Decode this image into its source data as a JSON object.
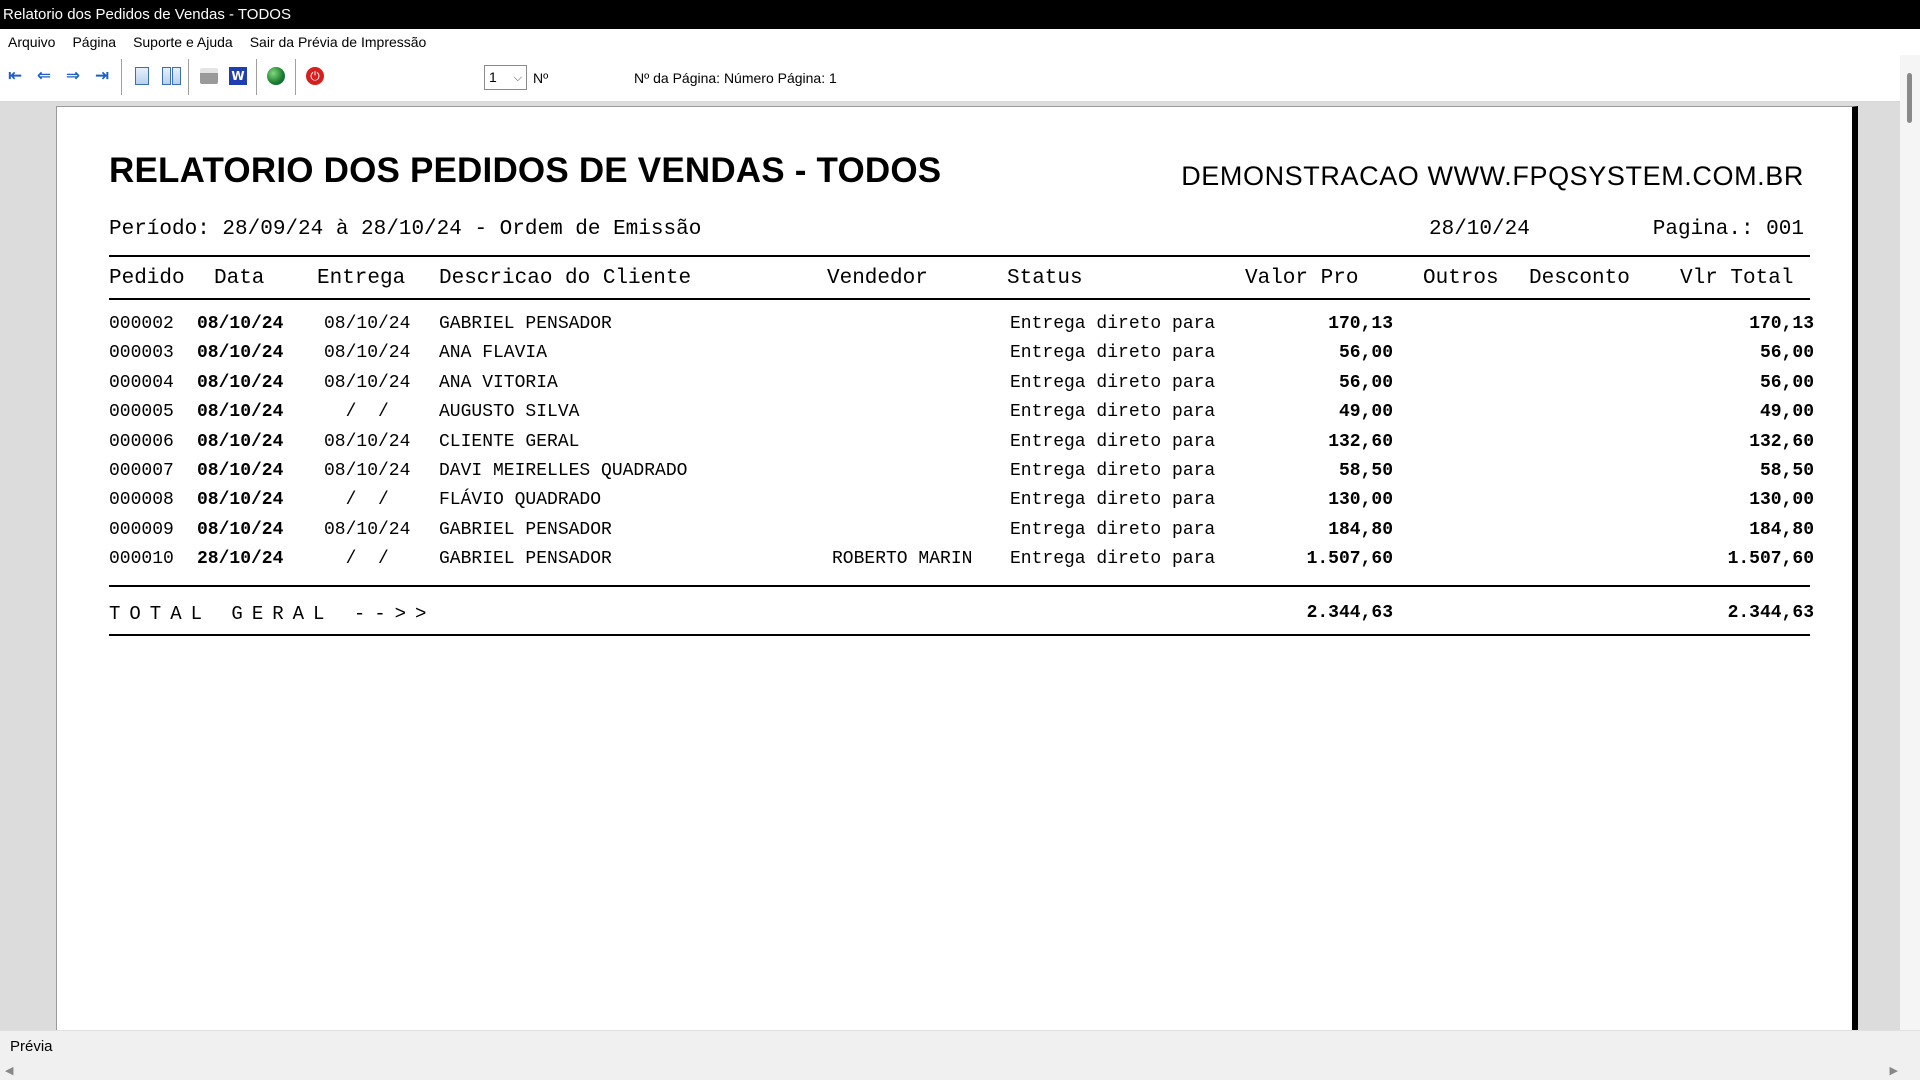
{
  "window": {
    "title": "Relatorio dos Pedidos de Vendas - TODOS"
  },
  "menu": [
    "Arquivo",
    "Página",
    "Suporte e Ajuda",
    "Sair da Prévia de Impressão"
  ],
  "toolbar": {
    "buttons": [
      "first-page-icon",
      "prev-page-icon",
      "next-page-icon",
      "last-page-icon",
      "single-page-icon",
      "two-pages-icon",
      "print-icon",
      "word-export-icon",
      "web-export-icon",
      "stop-icon"
    ],
    "page_select_value": "1",
    "n_label": "Nº",
    "page_info": "Nº da Página: Número Página: 1"
  },
  "report": {
    "title": "RELATORIO DOS PEDIDOS DE VENDAS - TODOS",
    "demo": "DEMONSTRACAO WWW.FPQSYSTEM.COM.BR",
    "periodo": "Período: 28/09/24 à 28/10/24 - Ordem de Emissão",
    "date": "28/10/24",
    "pagina": "Pagina.: 001",
    "columns": {
      "pedido": "Pedido",
      "data": "Data",
      "entrega": "Entrega",
      "cliente": "Descricao do Cliente",
      "vendedor": "Vendedor",
      "status": "Status",
      "valor": "Valor Pro",
      "outros": "Outros",
      "desconto": "Desconto",
      "total": "Vlr Total"
    },
    "rows": [
      {
        "pedido": "000002",
        "data": "08/10/24",
        "entrega": "08/10/24",
        "cliente": "GABRIEL PENSADOR",
        "vendedor": "",
        "status": "Entrega direto para",
        "valor": "170,13",
        "total": "170,13"
      },
      {
        "pedido": "000003",
        "data": "08/10/24",
        "entrega": "08/10/24",
        "cliente": "ANA FLAVIA",
        "vendedor": "",
        "status": "Entrega direto para",
        "valor": "56,00",
        "total": "56,00"
      },
      {
        "pedido": "000004",
        "data": "08/10/24",
        "entrega": "08/10/24",
        "cliente": "ANA VITORIA",
        "vendedor": "",
        "status": "Entrega direto para",
        "valor": "56,00",
        "total": "56,00"
      },
      {
        "pedido": "000005",
        "data": "08/10/24",
        "entrega": "  /  /",
        "cliente": "AUGUSTO SILVA",
        "vendedor": "",
        "status": "Entrega direto para",
        "valor": "49,00",
        "total": "49,00"
      },
      {
        "pedido": "000006",
        "data": "08/10/24",
        "entrega": "08/10/24",
        "cliente": "CLIENTE GERAL",
        "vendedor": "",
        "status": "Entrega direto para",
        "valor": "132,60",
        "total": "132,60"
      },
      {
        "pedido": "000007",
        "data": "08/10/24",
        "entrega": "08/10/24",
        "cliente": "DAVI MEIRELLES QUADRADO",
        "vendedor": "",
        "status": "Entrega direto para",
        "valor": "58,50",
        "total": "58,50"
      },
      {
        "pedido": "000008",
        "data": "08/10/24",
        "entrega": "  /  /",
        "cliente": "FLÁVIO QUADRADO",
        "vendedor": "",
        "status": "Entrega direto para",
        "valor": "130,00",
        "total": "130,00"
      },
      {
        "pedido": "000009",
        "data": "08/10/24",
        "entrega": "08/10/24",
        "cliente": "GABRIEL PENSADOR",
        "vendedor": "",
        "status": "Entrega direto para",
        "valor": "184,80",
        "total": "184,80"
      },
      {
        "pedido": "000010",
        "data": "28/10/24",
        "entrega": "  /  /",
        "cliente": "GABRIEL PENSADOR",
        "vendedor": "ROBERTO MARIN",
        "status": "Entrega direto para",
        "valor": "1.507,60",
        "total": "1.507,60"
      }
    ],
    "total_label": "TOTAL GERAL -->>",
    "total_valor": "2.344,63",
    "total_total": "2.344,63"
  },
  "status": {
    "text": "Prévia"
  }
}
